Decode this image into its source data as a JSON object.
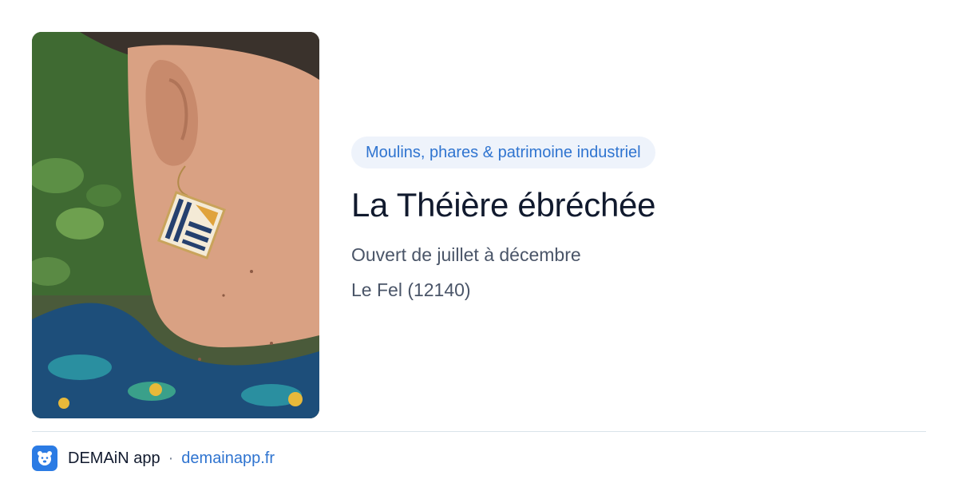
{
  "place": {
    "photo_alt": "",
    "category": "Moulins, phares & patrimoine industriel",
    "title": "La Théière ébréchée",
    "hours": "Ouvert de juillet à décembre",
    "location": "Le Fel (12140)"
  },
  "footer": {
    "app_name": "DEMAiN app",
    "separator": "·",
    "url": "demainapp.fr",
    "logo_icon": "bear-face-icon"
  },
  "colors": {
    "accent": "#2f74d0",
    "pill_background": "#eef3fb",
    "title": "#111a2e",
    "meta": "#4a5568",
    "divider": "#d9e3ea",
    "logo_background": "#2b7be4"
  }
}
